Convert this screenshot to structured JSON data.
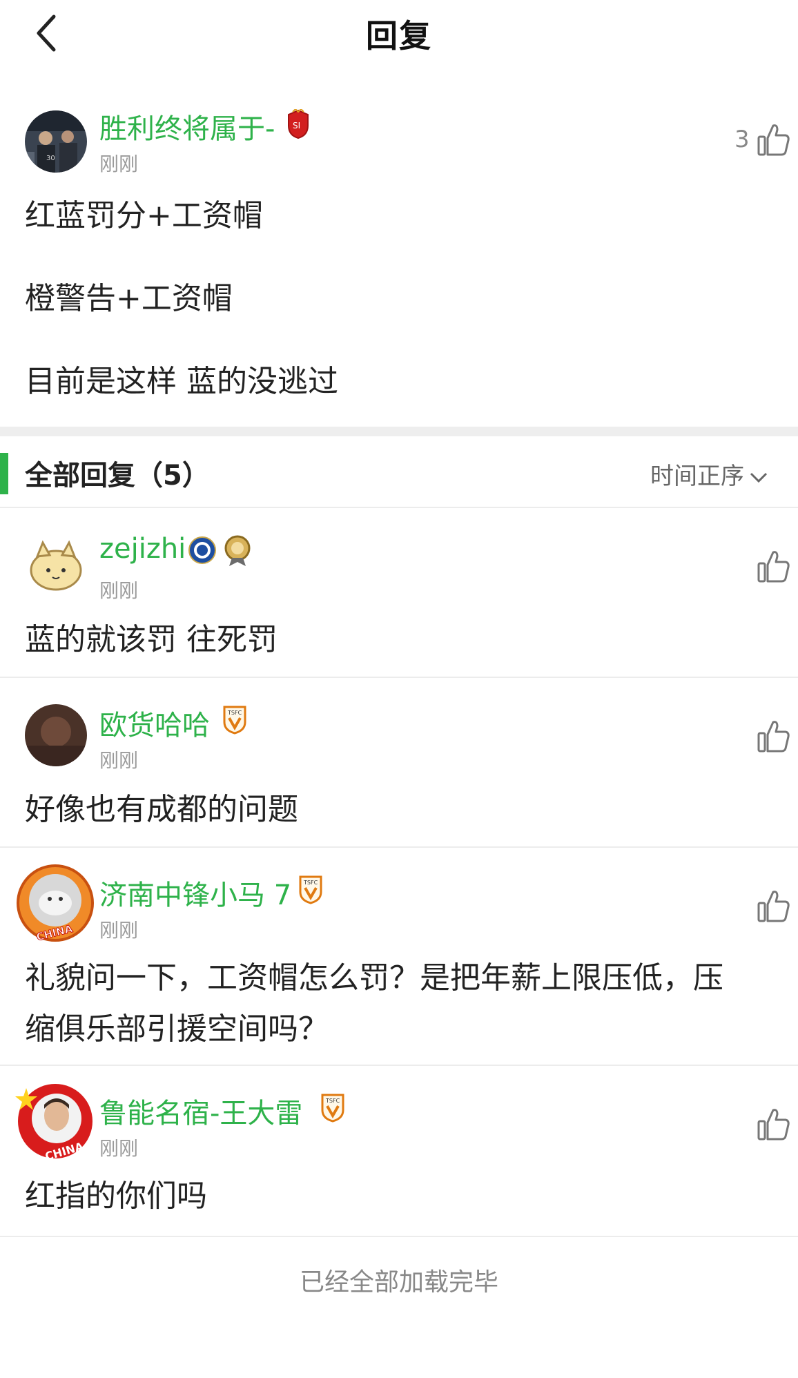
{
  "header": {
    "title": "回复",
    "back_icon": "chevron-left-icon"
  },
  "main_post": {
    "username": "胜利终将属于-",
    "time": "刚刚",
    "likes": "3",
    "lines": [
      "红蓝罚分+工资帽",
      "橙警告+工资帽",
      "目前是这样 蓝的没逃过"
    ]
  },
  "replies_header": {
    "title": "全部回复（5）",
    "sort": "时间正序"
  },
  "replies": [
    {
      "username": "zejizhi",
      "time": "刚刚",
      "lines": [
        "蓝的就该罚 往死罚"
      ]
    },
    {
      "username": "欧货哈哈",
      "time": "刚刚",
      "lines": [
        "好像也有成都的问题"
      ]
    },
    {
      "username": "济南中锋小马 7",
      "time": "刚刚",
      "lines": [
        "礼貌问一下，工资帽怎么罚？是把年薪上限压低，压",
        "缩俱乐部引援空间吗？"
      ],
      "avatar_text": "CHINA"
    },
    {
      "username": "鲁能名宿-王大雷",
      "time": "刚刚",
      "lines": [
        "红指的你们吗"
      ],
      "avatar_text": "CHINA"
    }
  ],
  "footer": {
    "end_text": "已经全部加载完毕"
  },
  "colors": {
    "accent_green": "#2eb24a",
    "muted_gray": "#9a9a9a"
  }
}
